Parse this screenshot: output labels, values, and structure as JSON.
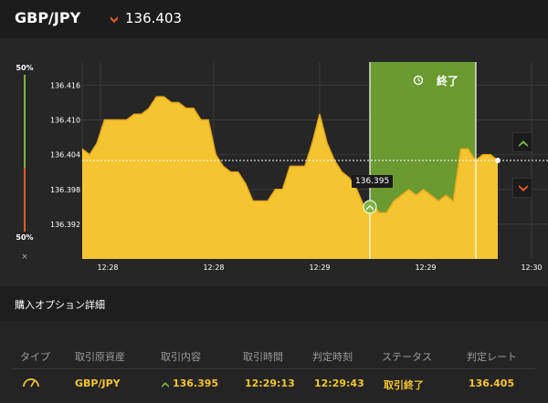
{
  "header": {
    "pair": "GBP/JPY",
    "rate": "136.403",
    "rate_icon": "down-arrow-icon",
    "colors": {
      "down": "#e45b2b",
      "up": "#7cb342",
      "gold": "#f5c431"
    }
  },
  "meter": {
    "top_label": "50%",
    "bottom_label": "50%",
    "close_label": "×"
  },
  "chart": {
    "end_label": "終了",
    "price_tag": "136.395",
    "y_ticks": [
      "136.416",
      "136.410",
      "136.404",
      "136.398",
      "136.392"
    ],
    "x_ticks": [
      "12:28",
      "12:28",
      "12:29",
      "12:29",
      "12:30"
    ]
  },
  "chart_data": {
    "type": "area",
    "x": [
      "12:28",
      "12:28",
      "12:29",
      "12:29",
      "12:30"
    ],
    "series": [
      {
        "values": [
          136.405,
          136.404,
          136.406,
          136.41,
          136.41,
          136.41,
          136.41,
          136.411,
          136.411,
          136.412,
          136.414,
          136.414,
          136.413,
          136.413,
          136.412,
          136.412,
          136.41,
          136.41,
          136.404,
          136.402,
          136.401,
          136.401,
          136.399,
          136.396,
          136.396,
          136.396,
          136.398,
          136.398,
          136.402,
          136.402,
          136.402,
          136.406,
          136.411,
          136.406,
          136.403,
          136.401,
          136.4,
          136.398,
          136.395,
          136.396,
          136.394,
          136.394,
          136.396,
          136.397,
          136.398,
          136.397,
          136.398,
          136.397,
          136.396,
          136.397,
          136.396,
          136.405,
          136.405,
          136.403,
          136.404,
          136.404,
          136.403
        ]
      }
    ],
    "ylim": [
      136.386,
      136.42
    ],
    "current_rate": 136.403,
    "entry_rate": 136.395
  },
  "details": {
    "title": "購入オプション詳細",
    "columns": [
      "タイプ",
      "取引原資産",
      "取引内容",
      "取引時間",
      "判定時刻",
      "ステータス",
      "判定レート"
    ],
    "row": {
      "type_icon": "gauge-icon",
      "asset": "GBP/JPY",
      "content": "136.395",
      "content_icon": "up-arrow-icon",
      "trade_time": "12:29:13",
      "judge_time": "12:29:43",
      "status": "取引終了",
      "judge_rate": "136.405"
    }
  }
}
